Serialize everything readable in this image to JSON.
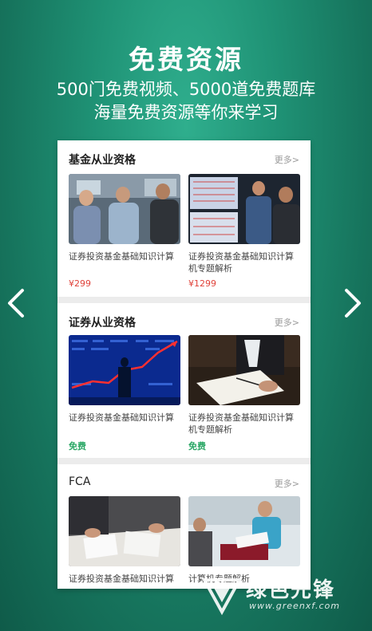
{
  "header": {
    "title": "免费资源",
    "subtitle_line1": "500门免费视频、5000道免费题库",
    "subtitle_line2": "海量免费资源等你来学习"
  },
  "nav": {
    "prev_icon": "chevron-left-icon",
    "next_icon": "chevron-right-icon"
  },
  "sections": [
    {
      "title": "基金从业资格",
      "more": "更多>",
      "items": [
        {
          "title": "证券投资基金基础知识计算",
          "price": "¥299"
        },
        {
          "title": "证券投资基金基础知识计算机专题解析",
          "price": "¥1299"
        }
      ]
    },
    {
      "title": "证券从业资格",
      "more": "更多>",
      "items": [
        {
          "title": "证券投资基金基础知识计算",
          "price": "免费"
        },
        {
          "title": "证券投资基金基础知识计算机专题解析",
          "price": "免费"
        }
      ]
    },
    {
      "title": "FCA",
      "more": "更多>",
      "items": [
        {
          "title": "证券投资基金基础知识计算",
          "price": ""
        },
        {
          "title": "计算机专题解析",
          "price": ""
        }
      ]
    }
  ],
  "watermark": {
    "name": "绿色先锋",
    "url": "www.greenxf.com"
  },
  "colors": {
    "background": "#1f9275",
    "price_paid": "#e0423a",
    "price_free": "#2aa765"
  }
}
